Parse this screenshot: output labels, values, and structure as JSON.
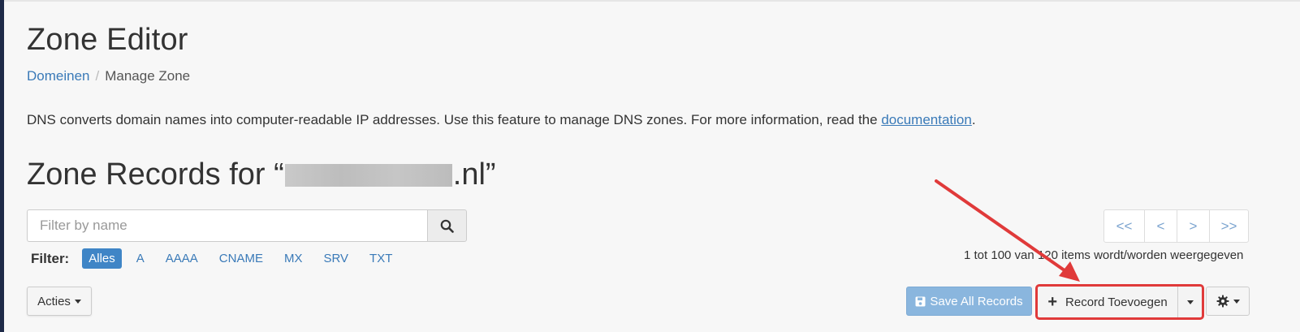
{
  "header": {
    "title": "Zone Editor",
    "breadcrumb": {
      "parent": "Domeinen",
      "separator": "/",
      "current": "Manage Zone"
    }
  },
  "intro": {
    "text": "DNS converts domain names into computer-readable IP addresses. Use this feature to manage DNS zones. For more information, read the ",
    "link": "documentation",
    "suffix": "."
  },
  "records": {
    "title_prefix": "Zone Records for “",
    "title_suffix": ".nl”"
  },
  "search": {
    "placeholder": "Filter by name",
    "icon": "search-icon"
  },
  "filter": {
    "label": "Filter:",
    "options": [
      "Alles",
      "A",
      "AAAA",
      "CNAME",
      "MX",
      "SRV",
      "TXT"
    ],
    "active": "Alles"
  },
  "actions": {
    "label": "Acties"
  },
  "pager": {
    "first": "<<",
    "prev": "<",
    "next": ">",
    "last": ">>"
  },
  "items_count": "1 tot 100 van 120 items wordt/worden weergegeven",
  "toolbar": {
    "save_label": "Save All Records",
    "save_icon": "floppy-disk-icon",
    "add_label": "Record Toevoegen",
    "add_icon": "plus-icon",
    "settings_icon": "gear-icon"
  },
  "colors": {
    "link": "#3a7ab8",
    "active_pill": "#3f85c6",
    "save_button": "#8ab6de",
    "annotation": "#e03a3a"
  }
}
